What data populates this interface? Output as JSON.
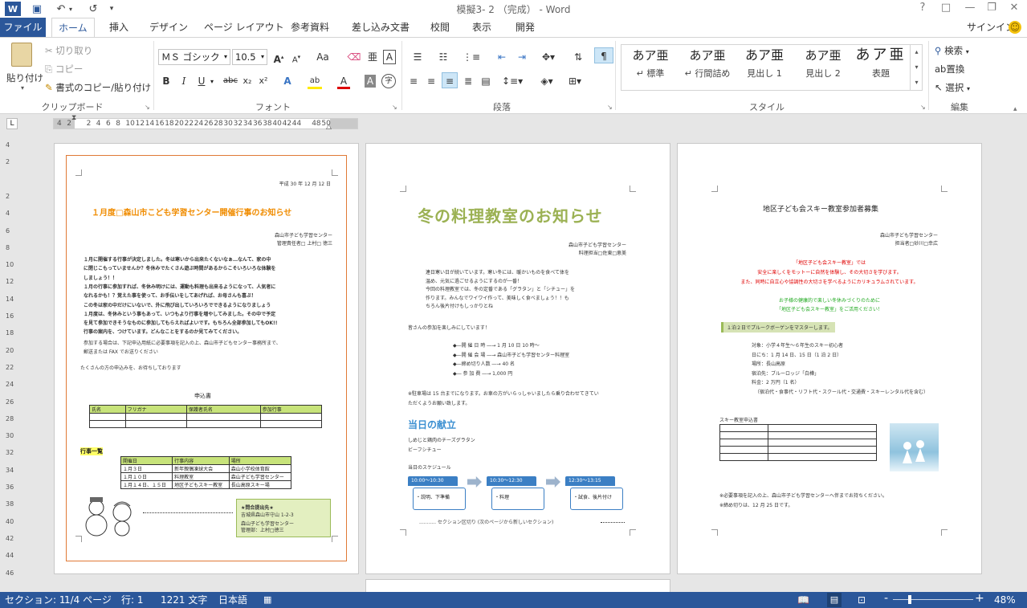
{
  "window": {
    "title": "模擬3- 2 （完成） - Word",
    "help": "?",
    "restore_ribbon": "□",
    "minimize": "—",
    "maximize": "❐",
    "close": "✕"
  },
  "qat": {
    "word": "W",
    "save": "💾",
    "undo": "↶",
    "redo": "↺",
    "custom": "▾"
  },
  "tabs": [
    "ファイル",
    "ホーム",
    "挿入",
    "デザイン",
    "ページ レイアウト",
    "参考資料",
    "差し込み文書",
    "校閲",
    "表示",
    "開発"
  ],
  "account": {
    "signin": "サインイン",
    "smiley": "☺"
  },
  "ribbon": {
    "clipboard": {
      "label": "クリップボード",
      "paste": "貼り付け",
      "cut": "切り取り",
      "copy": "コピー",
      "format_painter": "書式のコピー/貼り付け"
    },
    "font": {
      "label": "フォント",
      "name": "ＭＳ ゴシック",
      "size": "10.5",
      "grow": "A↑",
      "shrink": "A↓",
      "case": "Aa",
      "clear": "A",
      "frame": "A",
      "bold": "B",
      "italic": "I",
      "underline": "U",
      "strike": "abc",
      "sub": "x₂",
      "sup": "x²",
      "effect": "A",
      "highlight": "ab",
      "color": "A",
      "shade": "A",
      "enclose": "字"
    },
    "paragraph": {
      "label": "段落"
    },
    "styles": {
      "label": "スタイル",
      "items": [
        {
          "sample": "あア亜",
          "name": "↵ 標準"
        },
        {
          "sample": "あア亜",
          "name": "↵ 行間詰め"
        },
        {
          "sample": "あア亜",
          "name": "見出し 1"
        },
        {
          "sample": "あア亜",
          "name": "見出し 2"
        },
        {
          "sample": "あア亜",
          "name": "表題"
        }
      ]
    },
    "editing": {
      "label": "編集",
      "find": "検索",
      "replace": "置換",
      "select": "選択"
    }
  },
  "ruler": {
    "ticks": [
      "4",
      "2",
      "",
      "2",
      "4",
      "6",
      "8",
      "10",
      "12",
      "14",
      "16",
      "18",
      "20",
      "22",
      "24",
      "26",
      "28",
      "30",
      "32",
      "34",
      "36",
      "38",
      "40",
      "42",
      "44",
      "",
      "48",
      "50"
    ],
    "corner": "L"
  },
  "vruler": [
    "4",
    "2",
    "",
    "2",
    "4",
    "6",
    "8",
    "10",
    "12",
    "14",
    "16",
    "18",
    "20",
    "22",
    "24",
    "26",
    "28",
    "30",
    "32",
    "34",
    "36",
    "38",
    "40",
    "42",
    "44",
    "46"
  ],
  "page1": {
    "date": "平成 30 年 12 月 12 日",
    "title": "１月度□森山市こども学習センター開催行事のお知らせ",
    "org": "森山市子ども学習センター",
    "manager": "管理責任者□ 上村□ 徳三",
    "body": [
      "１月に開催する行事が決定しました。冬は寒いから出来たくないなぁ…なんて、家の中",
      "に閉じこもっていませんか？冬休みでたくさん遊ぶ時間があるからこそいろいろな体験を",
      "しましょう！！",
      "１月の行事に参加すれば、冬休み明けには、運動も料理も出来るようになって、人気者に",
      "なれるかも！？覚えた事を使って、お手伝いをしてあげれば、お母さんも喜ぶ！",
      "この冬は家の中だけにいないで、外に飛び出していろいろでできるようになりましょう",
      "１月度は、冬休みという事もあって、いつもより行事を増やしてみました。その中で予定",
      "を見て参加できそうなものに参加してもらえればよいです。もちろん全部参加してもOK!!",
      "行事の案内を、つけています。どんなことをするのか見てみてください。"
    ],
    "apply": [
      "参加する場合は、下記申込用紙に必要事項を記入の上、森山市子どもセンター事務所まで、",
      "郵送または FAX でお送りください"
    ],
    "closing": "たくさんの方の申込みを、お待ちしております",
    "form_title": "申込書",
    "form_headers": [
      "氏名",
      "フリガナ",
      "保護者氏名",
      "参加行事"
    ],
    "events_title": "行事一覧",
    "events": [
      [
        "開催日",
        "行事内容",
        "場所"
      ],
      [
        "１月３日",
        "新年親偶凍球大会",
        "森山小学校体育館"
      ],
      [
        "１月１０日",
        "料理教室",
        "森山子ども学習センター"
      ],
      [
        "１月１４日、１５日",
        "地区子どもスキー教室",
        "長山高原スキー場"
      ]
    ],
    "dest_title": "★問合提出先★",
    "dest": [
      "吉城県森山市守山 1-2-3",
      "森山子ども学習センター",
      "管理部：上村□徳三"
    ]
  },
  "page2": {
    "title": "冬の料理教室のお知らせ",
    "org": "森山市子ども学習センター",
    "person": "料理担当□佐東□恵美",
    "body": [
      "連日寒い日が続いています。寒い冬には、暖かいものを食べて体を",
      "温め、元気に過ごせるようにするのが一番！",
      "今回の料理教室では、冬の定番である「グラタン」と「シチュー」を",
      "作ります。みんなでワイワイ作って、美味しく食べましょう！！も",
      "ちろん後片付けもしっかりとね"
    ],
    "invite": "皆さんの参加を楽しみにしています！",
    "details": [
      "◆―開 催 日 時 ―→ 1 月 10 日 10 時～",
      "◆―開 催 会 場 ―→ 森山市子ども学習センター料理室",
      "◆―締め切り人数 ―→ 40 名",
      "◆― 参 加 費 ―→ 1,000 円"
    ],
    "note": [
      "※駐車場は 15 台までになります。お車の方がいらっしゃいましたら乗り合わせてきてい",
      "ただくようお願い致します。"
    ],
    "menu_title": "当日の献立",
    "menu": [
      "しめじと鶏肉のチーズグラタン",
      "ビーフシチュー"
    ],
    "schedule_title": "当日のスケジュール",
    "schedule": [
      {
        "time": "10:00～10:30",
        "desc": "・説明、下準備"
      },
      {
        "time": "10:30～12:30",
        "desc": "・料理"
      },
      {
        "time": "12:30～13:15",
        "desc": "・試食、後片付け"
      }
    ],
    "section_break": "セクション区切り (次のページから新しいセクション)"
  },
  "page3": {
    "title": "地区子ども会スキー教室参加者募集",
    "org": "森山市子ども学習センター",
    "person": "担当者□砂川□幸広",
    "red": [
      "「地区子ども会スキー教室」では",
      "安全に楽しくをモットーに自然を体験し、その大切さを学びます。",
      "また、同時に自立心や協調性の大切さを学べるようにカリキュラムされています。"
    ],
    "green": [
      "お子様の健康的で楽しい冬休みづくりのために",
      "「地区子ども会スキー教室」をご活用ください！"
    ],
    "banner": "１泊２日でプルークボーゲンをマスターします。",
    "info": [
      "対象：小学４年生～６年生のスキー初心者",
      "日にち：1 月 14 日、15 日（1 泊 2 日）",
      "場所：長山高原",
      "宿泊先：ブルーロッジ「白樺」",
      "料金：2 万円（1 名）",
      "（宿泊代・食事代・リフト代・スクール代・交通費・スキーレンタル代を含む）"
    ],
    "form_title": "スキー教室申込書",
    "footer": [
      "※必要事項を記入の上、森山市子ども学習センターへ伴までお持ちください。",
      "※締め切りは、12 月 25 日です。"
    ]
  },
  "status": {
    "section": "セクション: 1",
    "page": "1/4 ページ",
    "line": "行: 1",
    "words": "1221 文字",
    "lang": "日本語",
    "zoom": "48%",
    "minus": "-",
    "plus": "+"
  },
  "colors": {
    "accent": "#2b579a",
    "title_orange": "#f08c00",
    "title_green": "#9bb153",
    "menu_blue": "#3b8fd1"
  }
}
